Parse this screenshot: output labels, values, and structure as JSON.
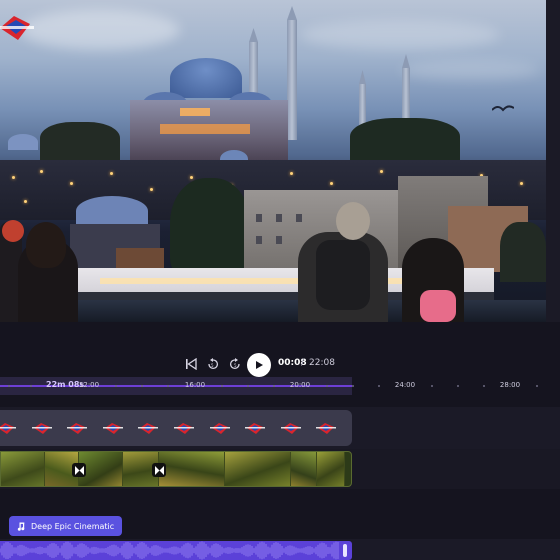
{
  "player": {
    "current_time": "00:08",
    "separator": "/",
    "total_time": "22:08"
  },
  "ruler": {
    "playhead_label": "22m 08s",
    "ticks": [
      "12:00",
      "16:00",
      "20:00",
      "24:00",
      "28:00"
    ]
  },
  "tracks": {
    "overlay": {
      "sticker_icon": "logo-sticker-icon",
      "sticker_count": 10
    },
    "video": {
      "transition_icon": "transition-icon"
    },
    "audio": {
      "label": "Deep Epic Cinematic",
      "icon": "music-note-icon"
    }
  },
  "colors": {
    "accent": "#5b41d8",
    "ruler_progress": "#6d3fd6",
    "music_label_bg": "#5a52e0",
    "app_background": "#15141f"
  }
}
